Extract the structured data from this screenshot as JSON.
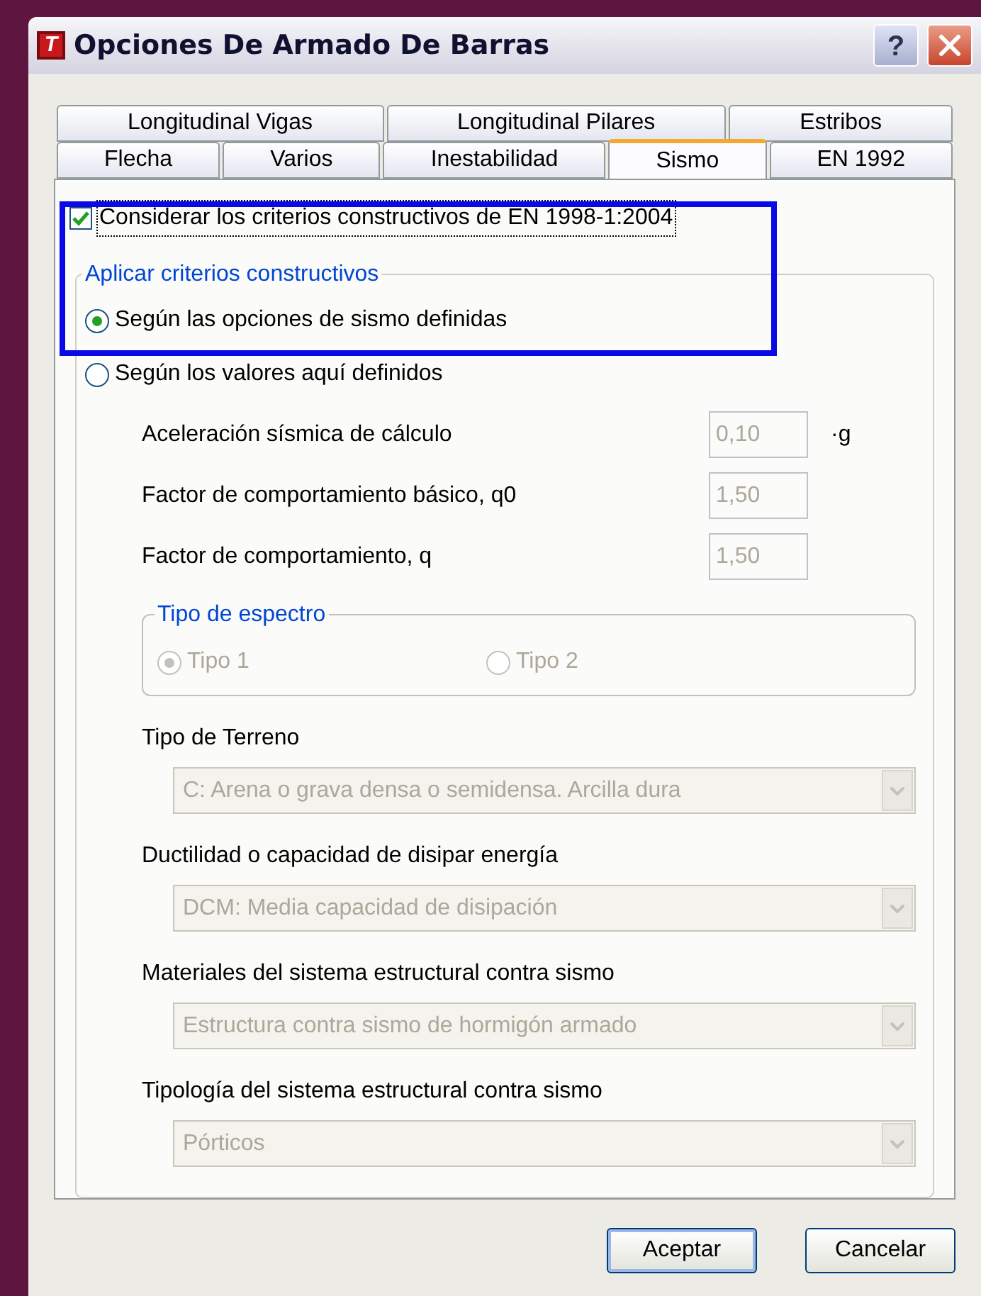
{
  "window": {
    "logo": "T",
    "title": "Opciones De Armado De Barras",
    "help": "?"
  },
  "tab_rows": [
    [
      {
        "label": "Longitudinal Vigas",
        "selected": false
      },
      {
        "label": "Longitudinal Pilares",
        "selected": false
      },
      {
        "label": "Estribos",
        "selected": false
      }
    ],
    [
      {
        "label": "Flecha",
        "selected": false
      },
      {
        "label": "Varios",
        "selected": false
      },
      {
        "label": "Inestabilidad",
        "selected": false
      },
      {
        "label": "Sismo",
        "selected": true
      },
      {
        "label": "EN 1992",
        "selected": false
      }
    ]
  ],
  "consider": {
    "label": "Considerar los criterios constructivos de EN 1998-1:2004",
    "checked": true
  },
  "apply_group": {
    "title": "Aplicar criterios constructivos",
    "options": [
      {
        "label": "Según las opciones de sismo definidas",
        "selected": true
      },
      {
        "label": "Según los valores aquí definidos",
        "selected": false
      }
    ],
    "params": [
      {
        "label": "Aceleración sísmica de cálculo",
        "value": "0,10",
        "unit": "·g",
        "disabled": true
      },
      {
        "label": "Factor de comportamiento básico, q0",
        "value": "1,50",
        "disabled": true
      },
      {
        "label": "Factor de comportamiento, q",
        "value": "1,50",
        "disabled": true
      }
    ],
    "spectrum": {
      "title": "Tipo de espectro",
      "options": [
        {
          "label": "Tipo 1",
          "selected": true,
          "disabled": true
        },
        {
          "label": "Tipo 2",
          "selected": false,
          "disabled": true
        }
      ]
    },
    "selects": [
      {
        "label": "Tipo de Terreno",
        "value": "C: Arena o grava densa o semidensa. Arcilla dura",
        "disabled": true
      },
      {
        "label": "Ductilidad o capacidad de disipar energía",
        "value": "DCM: Media capacidad de disipación",
        "disabled": true
      },
      {
        "label": "Materiales del sistema estructural contra sismo",
        "value": "Estructura contra sismo de hormigón armado",
        "disabled": true
      },
      {
        "label": "Tipología del sistema estructural contra sismo",
        "value": "Pórticos",
        "disabled": true
      }
    ]
  },
  "buttons": [
    "Aceptar",
    "Cancelar"
  ]
}
